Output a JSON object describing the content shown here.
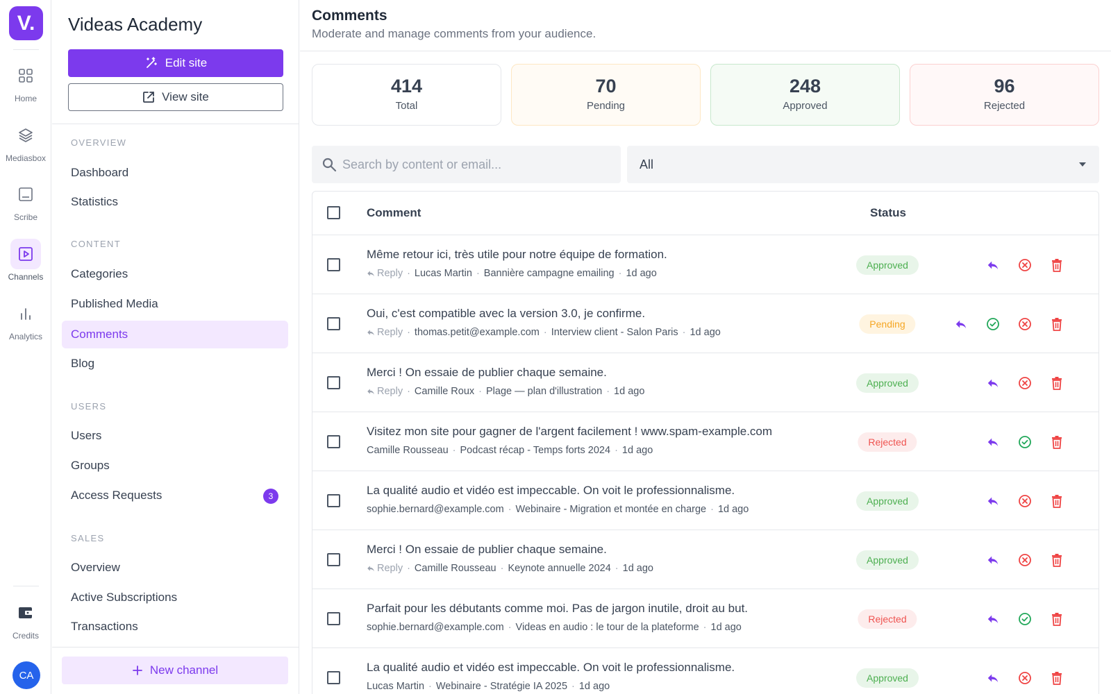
{
  "app": {
    "logo_text": "V.",
    "brand_color": "#7c3aed",
    "rail": [
      {
        "label": "Home",
        "icon": "grid-icon"
      },
      {
        "label": "Mediasbox",
        "icon": "layers-icon"
      },
      {
        "label": "Scribe",
        "icon": "document-icon"
      },
      {
        "label": "Channels",
        "icon": "play-icon"
      },
      {
        "label": "Analytics",
        "icon": "bar-chart-icon"
      }
    ],
    "credits_label": "Credits",
    "avatar_initials": "CA"
  },
  "sidebar": {
    "site_title": "Videas Academy",
    "edit_label": "Edit site",
    "view_label": "View site",
    "sections": {
      "overview": "OVERVIEW",
      "content": "CONTENT",
      "users": "USERS",
      "sales": "SALES"
    },
    "items": {
      "dashboard": "Dashboard",
      "statistics": "Statistics",
      "categories": "Categories",
      "published_media": "Published Media",
      "comments": "Comments",
      "blog": "Blog",
      "users": "Users",
      "groups": "Groups",
      "access_requests": "Access Requests",
      "access_requests_count": "3",
      "sales_overview": "Overview",
      "active_subscriptions": "Active Subscriptions",
      "transactions": "Transactions"
    },
    "new_channel_label": "New channel"
  },
  "main": {
    "title": "Comments",
    "subtitle": "Moderate and manage comments from your audience.",
    "stats": [
      {
        "value": "414",
        "label": "Total"
      },
      {
        "value": "70",
        "label": "Pending"
      },
      {
        "value": "248",
        "label": "Approved"
      },
      {
        "value": "96",
        "label": "Rejected"
      }
    ],
    "search_placeholder": "Search by content or email...",
    "filter_value": "All",
    "columns": {
      "comment": "Comment",
      "status": "Status"
    },
    "reply_label": "Reply",
    "rows": [
      {
        "text": "Même retour ici, très utile pour notre équipe de formation.",
        "reply": true,
        "author": "Lucas Martin",
        "media": "Bannière campagne emailing",
        "time": "1d ago",
        "status": "Approved"
      },
      {
        "text": "Oui, c'est compatible avec la version 3.0, je confirme.",
        "reply": true,
        "author": "thomas.petit@example.com",
        "media": "Interview client - Salon Paris",
        "time": "1d ago",
        "status": "Pending"
      },
      {
        "text": "Merci ! On essaie de publier chaque semaine.",
        "reply": true,
        "author": "Camille Roux",
        "media": "Plage — plan d'illustration",
        "time": "1d ago",
        "status": "Approved"
      },
      {
        "text": "Visitez mon site pour gagner de l'argent facilement ! www.spam-example.com",
        "reply": false,
        "author": "Camille Rousseau",
        "media": "Podcast récap - Temps forts 2024",
        "time": "1d ago",
        "status": "Rejected"
      },
      {
        "text": "La qualité audio et vidéo est impeccable. On voit le professionnalisme.",
        "reply": false,
        "author": "sophie.bernard@example.com",
        "media": "Webinaire - Migration et montée en charge",
        "time": "1d ago",
        "status": "Approved"
      },
      {
        "text": "Merci ! On essaie de publier chaque semaine.",
        "reply": true,
        "author": "Camille Rousseau",
        "media": "Keynote annuelle 2024",
        "time": "1d ago",
        "status": "Approved"
      },
      {
        "text": "Parfait pour les débutants comme moi. Pas de jargon inutile, droit au but.",
        "reply": false,
        "author": "sophie.bernard@example.com",
        "media": "Videas en audio : le tour de la plateforme",
        "time": "1d ago",
        "status": "Rejected"
      },
      {
        "text": "La qualité audio et vidéo est impeccable. On voit le professionnalisme.",
        "reply": false,
        "author": "Lucas Martin",
        "media": "Webinaire - Stratégie IA 2025",
        "time": "1d ago",
        "status": "Approved"
      }
    ]
  }
}
